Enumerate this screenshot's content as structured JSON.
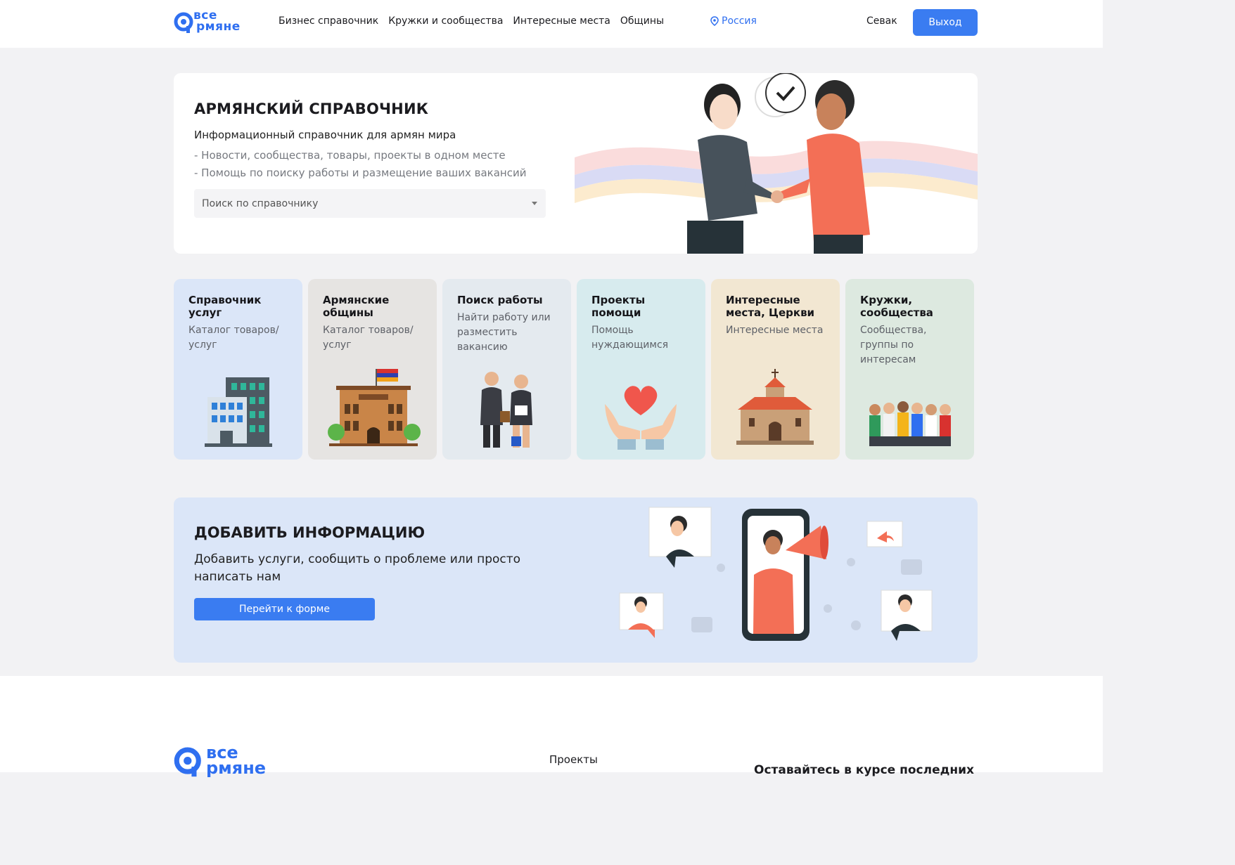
{
  "header": {
    "logo": {
      "line1": "все",
      "line2": "рмяне"
    },
    "nav": [
      "Бизнес справочник",
      "Кружки и сообщества",
      "Интересные места",
      "Общины"
    ],
    "region": "Россия",
    "user": "Севак",
    "logout": "Выход"
  },
  "hero": {
    "title": "АРМЯНСКИЙ СПРАВОЧНИК",
    "subtitle": "Информационный справочник для армян мира",
    "line1": "- Новости, сообщества, товары, проекты в одном месте",
    "line2": "- Помощь по поиску работы и размещение ваших вакансий",
    "search_placeholder": "Поиск по справочнику"
  },
  "cards": [
    {
      "title": "Справочник услуг",
      "desc": "Каталог товаров/ услуг",
      "bg": "#dbe6f8",
      "icon": "office-building-icon"
    },
    {
      "title": "Армянские общины",
      "desc": "Каталог товаров/ услуг",
      "bg": "#e6e4e2",
      "icon": "community-building-icon"
    },
    {
      "title": "Поиск работы",
      "desc": "Найти работу или разместить вакансию",
      "bg": "#e4eaef",
      "icon": "job-seekers-icon"
    },
    {
      "title": "Проекты помощи",
      "desc": "Помощь нуждающимся",
      "bg": "#d7ebee",
      "icon": "heart-hands-icon"
    },
    {
      "title": "Интересные места, Церкви",
      "desc": "Интересные места",
      "bg": "#f2e7d2",
      "icon": "church-icon"
    },
    {
      "title": "Кружки, сообщества",
      "desc": "Сообщества, группы по интересам",
      "bg": "#dde9e0",
      "icon": "group-people-icon"
    }
  ],
  "addinfo": {
    "title": "ДОБАВИТЬ ИНФОРМАЦИЮ",
    "text": "Добавить услуги, сообщить о проблеме или просто написать нам",
    "button": "Перейти к форме"
  },
  "footer": {
    "logo": {
      "line1": "все",
      "line2": "рмяне"
    },
    "projects": "Проекты",
    "newsletter": "Оставайтесь в курсе последних"
  },
  "colors": {
    "accent": "#3a7cf1",
    "logo": "#2f6ff0"
  }
}
